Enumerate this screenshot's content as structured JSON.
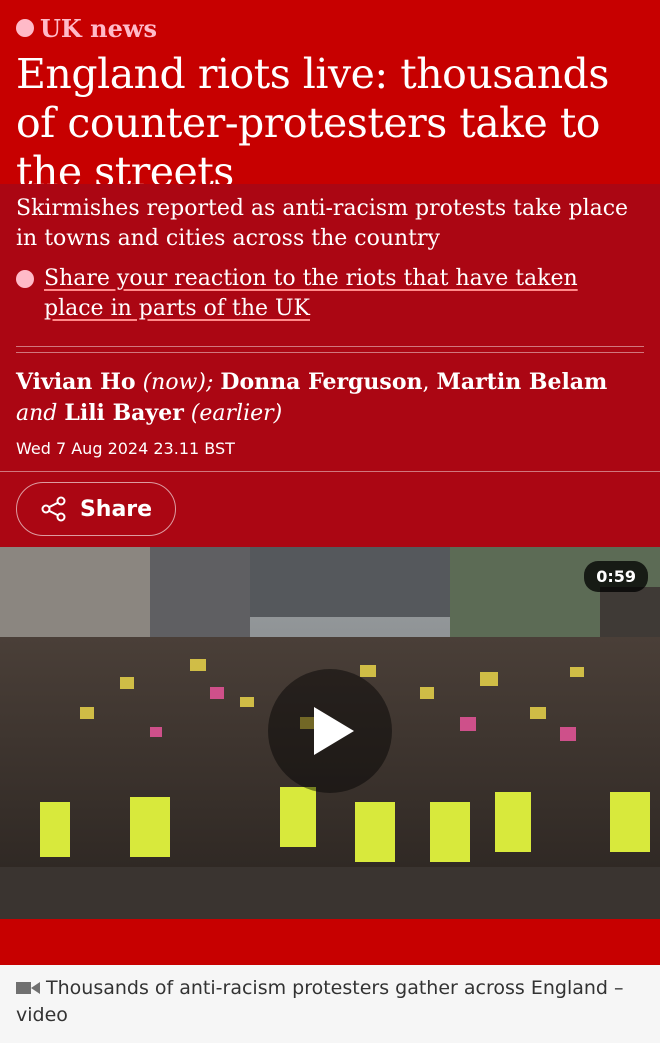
{
  "kicker": "UK news",
  "headline": "England riots live: thousands of counter-protesters take to the streets",
  "standfirst": "Skirmishes reported as anti-racism protests take place in towns and cities across the country",
  "related_link": "Share your reaction to the riots that have taken place in parts of the UK",
  "byline": {
    "author1": "Vivian Ho",
    "author1_note": "(now);",
    "author2": "Donna Ferguson",
    "sep1": ",",
    "author3": "Martin Belam",
    "and": "and",
    "author4": "Lili Bayer",
    "author4_note": "(earlier)"
  },
  "dateline": "Wed 7 Aug 2024 23.11 BST",
  "share_label": "Share",
  "video": {
    "duration": "0:59",
    "caption": "Thousands of anti-racism protesters gather across England – video"
  },
  "colors": {
    "header_bg": "#c70000",
    "body_bg": "#ab0613",
    "kicker": "#ffbac8"
  },
  "icons": [
    "dot-icon",
    "share-icon",
    "play-icon",
    "video-camera-icon"
  ]
}
